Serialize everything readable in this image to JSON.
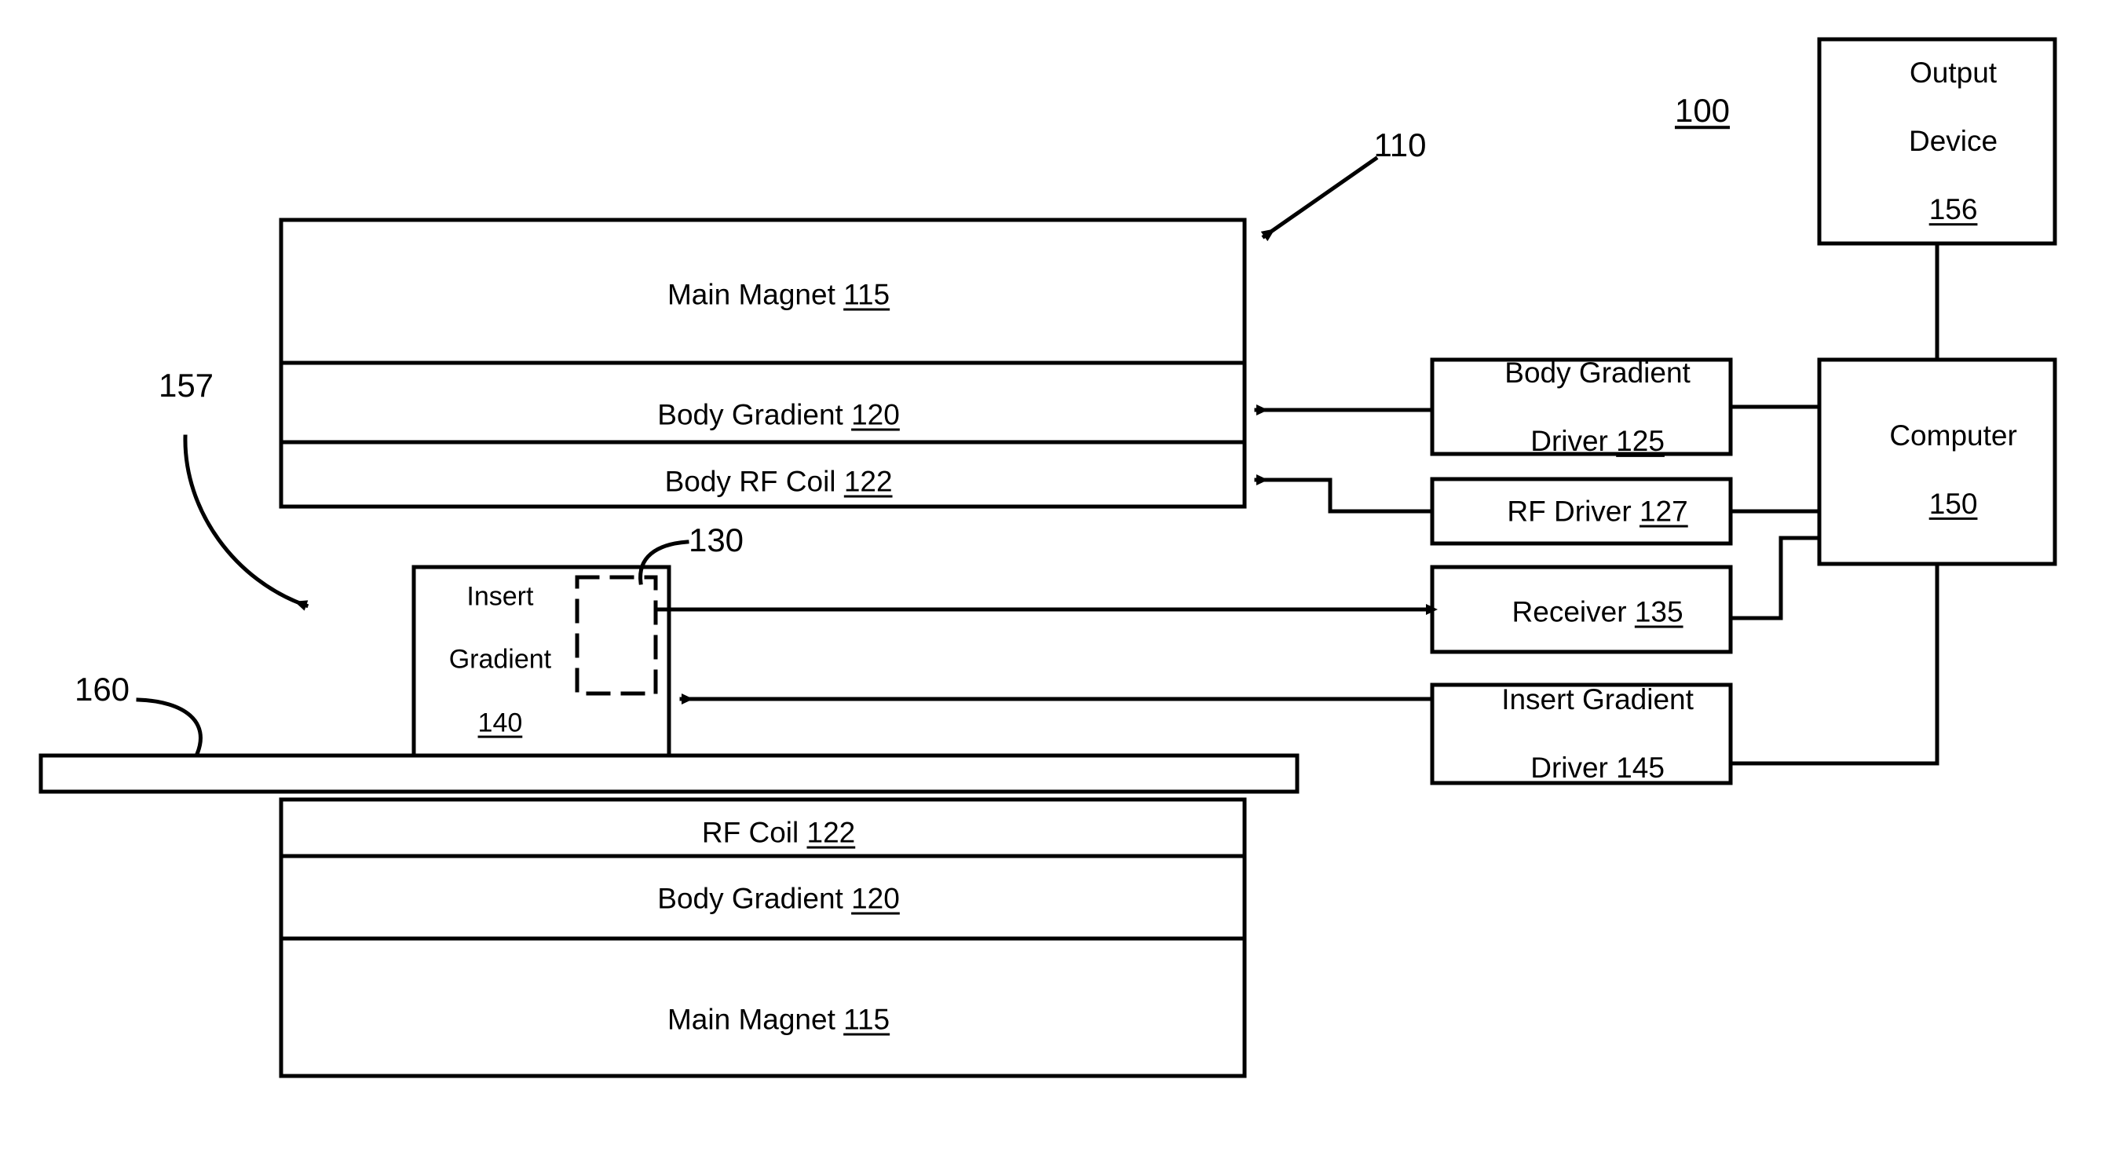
{
  "figure": {
    "type": "patent-block-diagram",
    "title_ref": "100",
    "system_ref": "110"
  },
  "scanner": {
    "top_assembly": [
      {
        "name": "Main Magnet",
        "ref": "115"
      },
      {
        "name": "Body Gradient",
        "ref": "120"
      },
      {
        "name": "Body RF Coil",
        "ref": "122"
      }
    ],
    "bottom_assembly": [
      {
        "name": "RF Coil",
        "ref": "122"
      },
      {
        "name": "Body Gradient",
        "ref": "120"
      },
      {
        "name": "Main Magnet",
        "ref": "115"
      }
    ],
    "insert": {
      "line1": "Insert",
      "line2": "Gradient",
      "ref": "140",
      "inner_region_ref": "130"
    },
    "patient_table_ref": "160",
    "bore_ref": "157"
  },
  "electronics": {
    "output_device": {
      "line1": "Output",
      "line2": "Device",
      "ref": "156"
    },
    "computer": {
      "name": "Computer",
      "ref": "150"
    },
    "body_gradient_driver": {
      "line1": "Body Gradient",
      "line2": "Driver",
      "ref": "125"
    },
    "rf_driver": {
      "name": "RF Driver",
      "ref": "127"
    },
    "receiver": {
      "name": "Receiver",
      "ref": "135"
    },
    "insert_gradient_driver": {
      "line1": "Insert Gradient",
      "line2": "Driver",
      "ref": "145"
    }
  },
  "colors": {
    "ink": "#000000",
    "paper": "#ffffff"
  }
}
